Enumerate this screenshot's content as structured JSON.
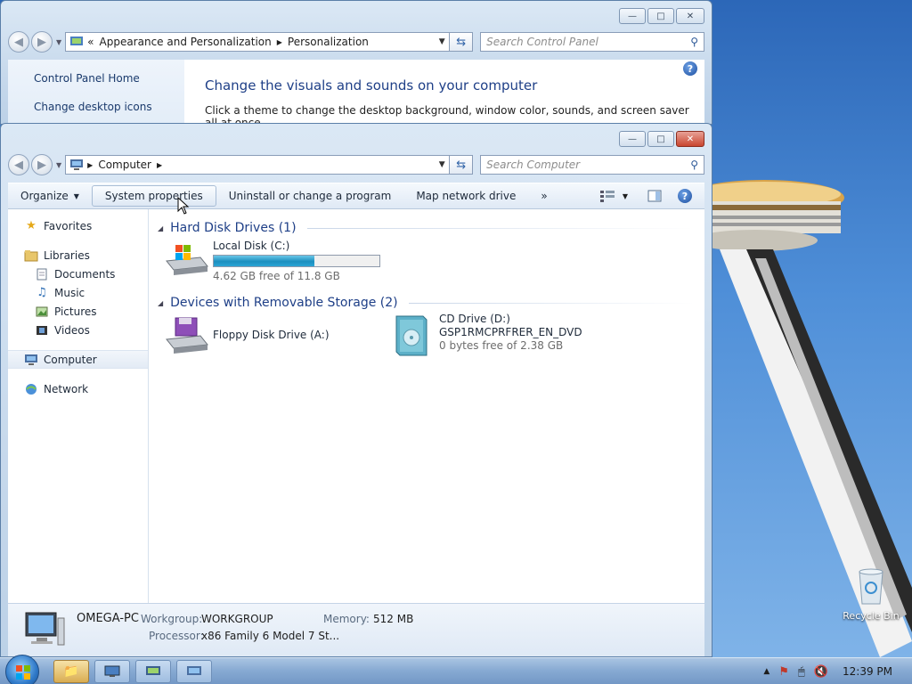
{
  "desktop": {
    "recycle_bin_label": "Recycle Bin"
  },
  "back_window": {
    "address": {
      "overflow": "«",
      "crumbs": [
        "Appearance and Personalization",
        "Personalization"
      ]
    },
    "search_placeholder": "Search Control Panel",
    "sidebar_links": [
      "Control Panel Home",
      "Change desktop icons"
    ],
    "heading": "Change the visuals and sounds on your computer",
    "description": "Click a theme to change the desktop background, window color, sounds, and screen saver all at once."
  },
  "front_window": {
    "address": {
      "crumb": "Computer"
    },
    "search_placeholder": "Search Computer",
    "toolbar": {
      "organize": "Organize",
      "system_properties": "System properties",
      "uninstall": "Uninstall or change a program",
      "map_network": "Map network drive",
      "more": "»"
    },
    "nav": {
      "favorites": "Favorites",
      "libraries": "Libraries",
      "documents": "Documents",
      "music": "Music",
      "pictures": "Pictures",
      "videos": "Videos",
      "computer": "Computer",
      "network": "Network"
    },
    "groups": {
      "hard_disk": "Hard Disk Drives (1)",
      "removable": "Devices with Removable Storage (2)"
    },
    "drives": {
      "local_disk": {
        "name": "Local Disk (C:)",
        "free_text": "4.62 GB free of 11.8 GB",
        "used_fraction": 0.61
      },
      "floppy": {
        "name": "Floppy Disk Drive (A:)"
      },
      "cd": {
        "name": "CD Drive (D:)",
        "label": "GSP1RMCPRFRER_EN_DVD",
        "free_text": "0 bytes free of 2.38 GB"
      }
    },
    "details": {
      "computer_name": "OMEGA-PC",
      "workgroup_label": "Workgroup:",
      "workgroup_value": "WORKGROUP",
      "memory_label": "Memory:",
      "memory_value": "512 MB",
      "processor_label": "Processor:",
      "processor_value": "x86 Family 6 Model 7 St..."
    }
  },
  "taskbar": {
    "clock": "12:39 PM"
  },
  "colors": {
    "link_blue": "#1e3f87",
    "progress_fill": "#1c8fbf"
  }
}
